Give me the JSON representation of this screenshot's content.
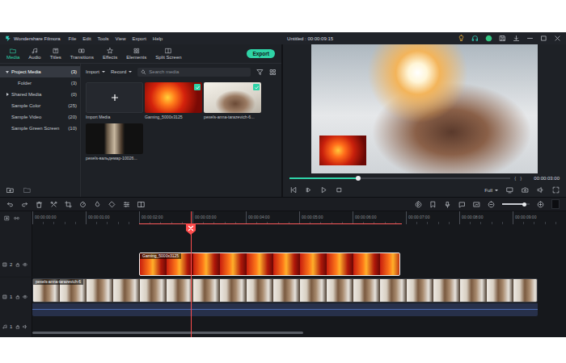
{
  "window": {
    "app_name": "Wondershare Filmora",
    "title": "Untitled : 00:00:09:15"
  },
  "menu": [
    "File",
    "Edit",
    "Tools",
    "View",
    "Export",
    "Help"
  ],
  "tabs": [
    {
      "label": "Media",
      "selected": true
    },
    {
      "label": "Audio",
      "selected": false
    },
    {
      "label": "Titles",
      "selected": false
    },
    {
      "label": "Transitions",
      "selected": false
    },
    {
      "label": "Effects",
      "selected": false
    },
    {
      "label": "Elements",
      "selected": false
    },
    {
      "label": "Split Screen",
      "selected": false
    }
  ],
  "export_button": "Export",
  "sidebar": {
    "items": [
      {
        "label": "Project Media",
        "count": "(3)",
        "kind": "group",
        "expanded": true,
        "selected": true
      },
      {
        "label": "Folder",
        "count": "(3)",
        "kind": "child",
        "expanded": false,
        "selected": false
      },
      {
        "label": "Shared Media",
        "count": "(0)",
        "kind": "group",
        "expanded": false,
        "selected": false
      },
      {
        "label": "Sample Color",
        "count": "(25)",
        "kind": "leaf",
        "expanded": false,
        "selected": false
      },
      {
        "label": "Sample Video",
        "count": "(20)",
        "kind": "leaf",
        "expanded": false,
        "selected": false
      },
      {
        "label": "Sample Green Screen",
        "count": "(10)",
        "kind": "leaf",
        "expanded": false,
        "selected": false
      }
    ]
  },
  "media_toolbar": {
    "import": "Import",
    "record": "Record",
    "search_placeholder": "Search media"
  },
  "media": [
    {
      "name": "Import Media",
      "kind": "import",
      "checked": false
    },
    {
      "name": "Gaming_5000x3125",
      "kind": "image",
      "checked": true
    },
    {
      "name": "pexels-anna-tarazevich-6...",
      "kind": "video",
      "checked": true
    },
    {
      "name": "pexels-вальдемар-10026...",
      "kind": "video",
      "checked": false
    }
  ],
  "preview": {
    "level": 0.31,
    "in_mark": "{",
    "out_mark": "}",
    "time": "00:00:03:00",
    "quality": "Full"
  },
  "timeline": {
    "ruler": [
      "00:00:00:00",
      "00:00:01:00",
      "00:00:02:00",
      "00:00:03:00",
      "00:00:04:00",
      "00:00:05:00",
      "00:00:06:00",
      "00:00:07:00",
      "00:00:08:00",
      "00:00:09:00"
    ],
    "zoom_level": 0.8,
    "tracks": [
      {
        "label": "2",
        "clip": "Gaming_5000x3125",
        "kind": "image"
      },
      {
        "label": "1",
        "clip": "pexels-anna-tarazevich-6",
        "kind": "video"
      }
    ],
    "audio_tracks": [
      {
        "label": "1"
      }
    ]
  }
}
